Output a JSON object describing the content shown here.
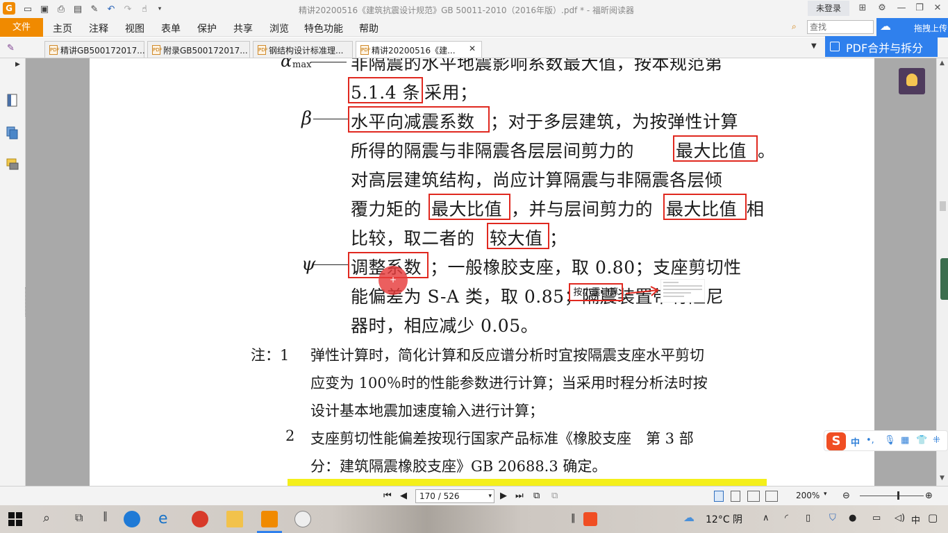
{
  "window": {
    "title": "精讲20200516《建筑抗震设计规范》GB 50011-2010（2016年版）.pdf * - 福昕阅读器",
    "login_label": "未登录",
    "controls": [
      "restore-grid-icon",
      "settings-icon",
      "minimize-icon",
      "maximize-icon",
      "close-icon"
    ]
  },
  "menubar": {
    "file": "文件",
    "items": [
      "主页",
      "注释",
      "视图",
      "表单",
      "保护",
      "共享",
      "浏览",
      "特色功能",
      "帮助"
    ],
    "search_placeholder": "查找",
    "cloud_upload": "拖拽上传"
  },
  "tabs": [
    {
      "label": "精讲GB500172017...",
      "active": false
    },
    {
      "label": "附录GB500172017...",
      "active": false
    },
    {
      "label": "钢结构设计标准理...",
      "active": false
    },
    {
      "label": "精讲20200516《建...",
      "active": true
    }
  ],
  "pdf_merge_label": "PDF合并与拆分",
  "document": {
    "alpha_symbol": "α",
    "alpha_subscript": "max",
    "line1": "非隔震的水平地震影响系数最大值，按本规范第",
    "line2_boxed": "5.1.4 条",
    "line2_rest": "采用；",
    "beta_symbol": "β",
    "beta_boxed": "水平向减震系数",
    "beta_rest": "；对于多层建筑，为按弹性计算",
    "line4_a": "所得的隔震与非隔震各层层间剪力的",
    "line4_boxed": "最大比值",
    "line4_end": "。",
    "line5": "对高层建筑结构，尚应计算隔震与非隔震各层倾",
    "line6_a": "覆力矩的",
    "line6_boxed1": "最大比值",
    "line6_b": "，并与层间剪力的",
    "line6_boxed2": "最大比值",
    "line6_end": "相",
    "line7_a": "比较，取二者的",
    "line7_boxed": "较大值",
    "line7_end": "；",
    "annotation": "按小震计算",
    "psi_symbol": "ψ",
    "psi_boxed": "调整系数",
    "psi_rest": "；一般橡胶支座，取 0.80；支座剪切性",
    "line9": "能偏差为 S-A 类，取 0.85；隔震装置带有阻尼",
    "line10": "器时，相应减少 0.05。",
    "note_prefix": "注：1",
    "note1_l1": "弹性计算时，简化计算和反应谱分析时宜按隔震支座水平剪切",
    "note1_l2": "应变为 100％时的性能参数进行计算；当采用时程分析法时按",
    "note1_l3": "设计基本地震加速度输入进行计算；",
    "note2_num": "2",
    "note2_l1": "支座剪切性能偏差按现行国家产品标准《橡胶支座　第 3 部",
    "note2_l2": "分：建筑隔震橡胶支座》GB 20688.3 确定。"
  },
  "ime": {
    "mode": "中",
    "punct": "•,"
  },
  "statusbar": {
    "page_value": "170 / 526",
    "zoom": "200%"
  },
  "taskbar": {
    "weather": "12°C 阴",
    "ime_indicator": "中"
  },
  "colors": {
    "accent_orange": "#f08a00",
    "highlight_red": "#e0281f",
    "cloud_blue": "#2f80ed"
  }
}
